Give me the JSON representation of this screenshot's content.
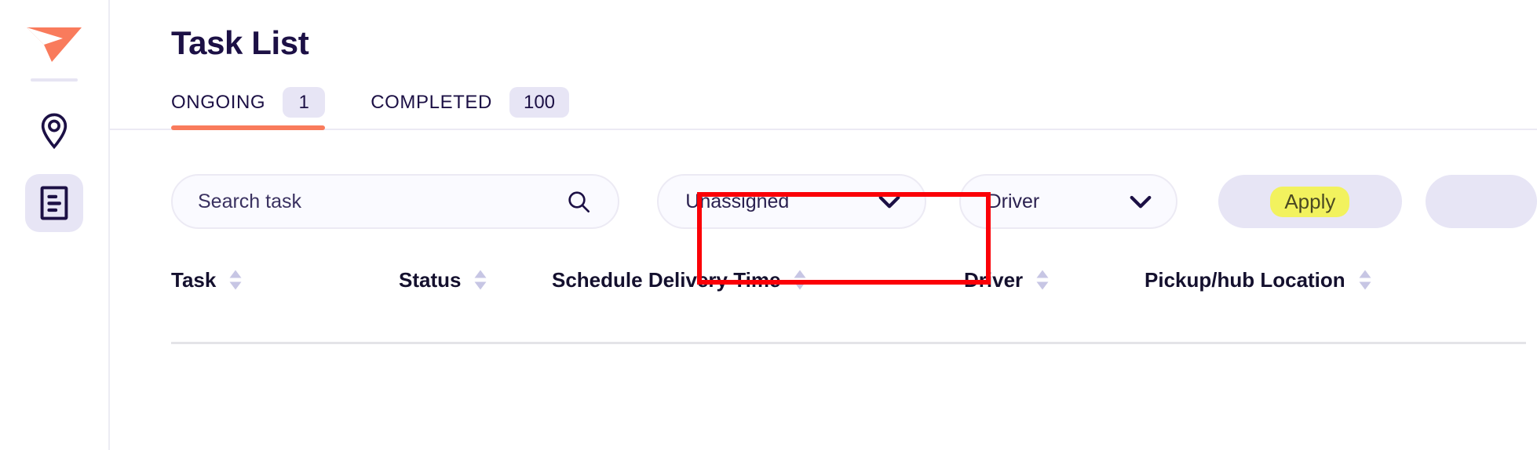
{
  "sidebar": {
    "logo": {
      "name": "paper-plane-logo",
      "color": "#f97b5c"
    },
    "items": [
      {
        "name": "location-pin",
        "label": "Map",
        "active": false
      },
      {
        "name": "task-list-document",
        "label": "Task List",
        "active": true
      }
    ]
  },
  "header": {
    "title": "Task List"
  },
  "tabs": [
    {
      "label": "ONGOING",
      "badge": "1",
      "active": true
    },
    {
      "label": "COMPLETED",
      "badge": "100",
      "active": false
    }
  ],
  "filters": {
    "search": {
      "placeholder": "Search task",
      "value": "",
      "icon": "search-icon"
    },
    "assignment_select": {
      "value": "Unassigned",
      "icon": "chevron-down-icon"
    },
    "driver_select": {
      "value": "Driver",
      "icon": "chevron-down-icon"
    },
    "apply_button": {
      "label": "Apply",
      "highlight_color": "#f2f25e"
    },
    "secondary_button": {
      "label": ""
    }
  },
  "table": {
    "columns": [
      {
        "label": "Task",
        "sortable": true
      },
      {
        "label": "Status",
        "sortable": true
      },
      {
        "label": "Schedule Delivery Time",
        "sortable": true
      },
      {
        "label": "Driver",
        "sortable": true
      },
      {
        "label": "Pickup/hub Location",
        "sortable": true
      }
    ],
    "rows": []
  },
  "annotation": {
    "target": "Unassigned",
    "color": "#fb0007"
  },
  "colors": {
    "accent": "#f97b5c",
    "navy": "#1c1045",
    "lavender": "#e7e5f5",
    "field_bg": "#fafaff",
    "border": "#eceaf4"
  }
}
